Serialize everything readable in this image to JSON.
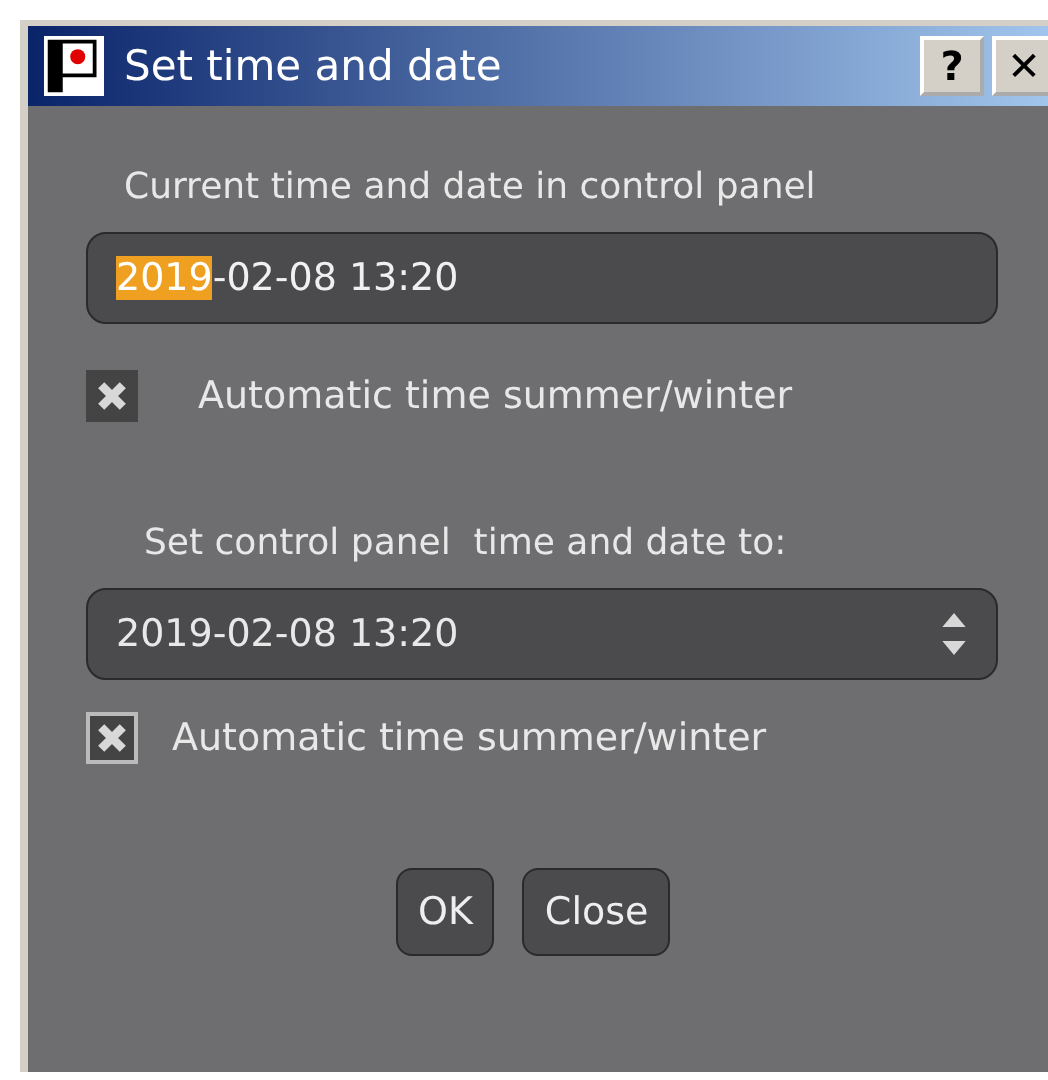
{
  "window": {
    "title": "Set time and date",
    "title_buttons": [
      "?",
      "✕"
    ]
  },
  "current": {
    "label": "Current time and date in control panel",
    "segments": [
      {
        "text": "2019",
        "selected": true
      },
      {
        "text": "-02-08 13:20",
        "selected": false
      }
    ],
    "checkbox": {
      "label": "Automatic time summer/winter",
      "checked": true
    }
  },
  "target": {
    "label": "Set control panel  time and date to:",
    "value": "2019-02-08 13:20",
    "checkbox": {
      "label": "Automatic time summer/winter",
      "checked": true
    }
  },
  "buttons": [
    "OK",
    "Close"
  ]
}
